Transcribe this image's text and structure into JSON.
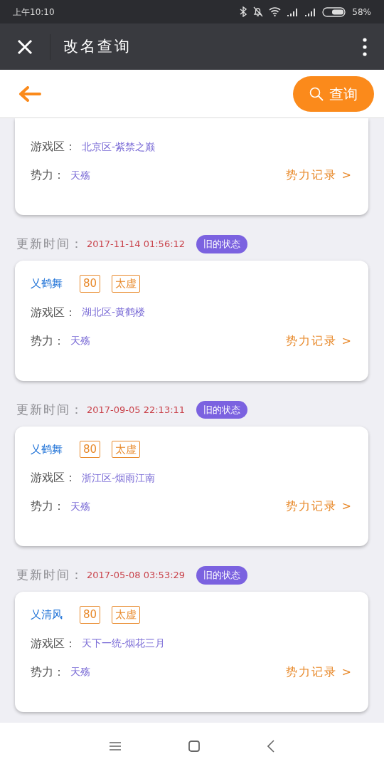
{
  "status_bar": {
    "time": "上午10:10",
    "battery": "58%"
  },
  "title_bar": {
    "title": "改名查询"
  },
  "toolbar": {
    "search_button": "查询"
  },
  "records": [
    {
      "zone_label": "游戏区：",
      "zone": "北京区-紫禁之巅",
      "faction_label": "势力：",
      "faction": "天殇",
      "link": "势力记录 >"
    },
    {
      "update_label": "更新时间：",
      "update_time": "2017-11-14 01:56:12",
      "status_badge": "旧的状态",
      "name": "乂鹤舞",
      "level": "80",
      "school": "太虚",
      "zone_label": "游戏区：",
      "zone": "湖北区-黄鹤楼",
      "faction_label": "势力：",
      "faction": "天殇",
      "link": "势力记录 >"
    },
    {
      "update_label": "更新时间：",
      "update_time": "2017-09-05 22:13:11",
      "status_badge": "旧的状态",
      "name": "乂鹤舞",
      "level": "80",
      "school": "太虚",
      "zone_label": "游戏区：",
      "zone": "浙江区-烟雨江南",
      "faction_label": "势力：",
      "faction": "天殇",
      "link": "势力记录 >"
    },
    {
      "update_label": "更新时间：",
      "update_time": "2017-05-08 03:53:29",
      "status_badge": "旧的状态",
      "name": "乂清风",
      "level": "80",
      "school": "太虚",
      "zone_label": "游戏区：",
      "zone": "天下一统-烟花三月",
      "faction_label": "势力：",
      "faction": "天殇",
      "link": "势力记录 >"
    }
  ]
}
